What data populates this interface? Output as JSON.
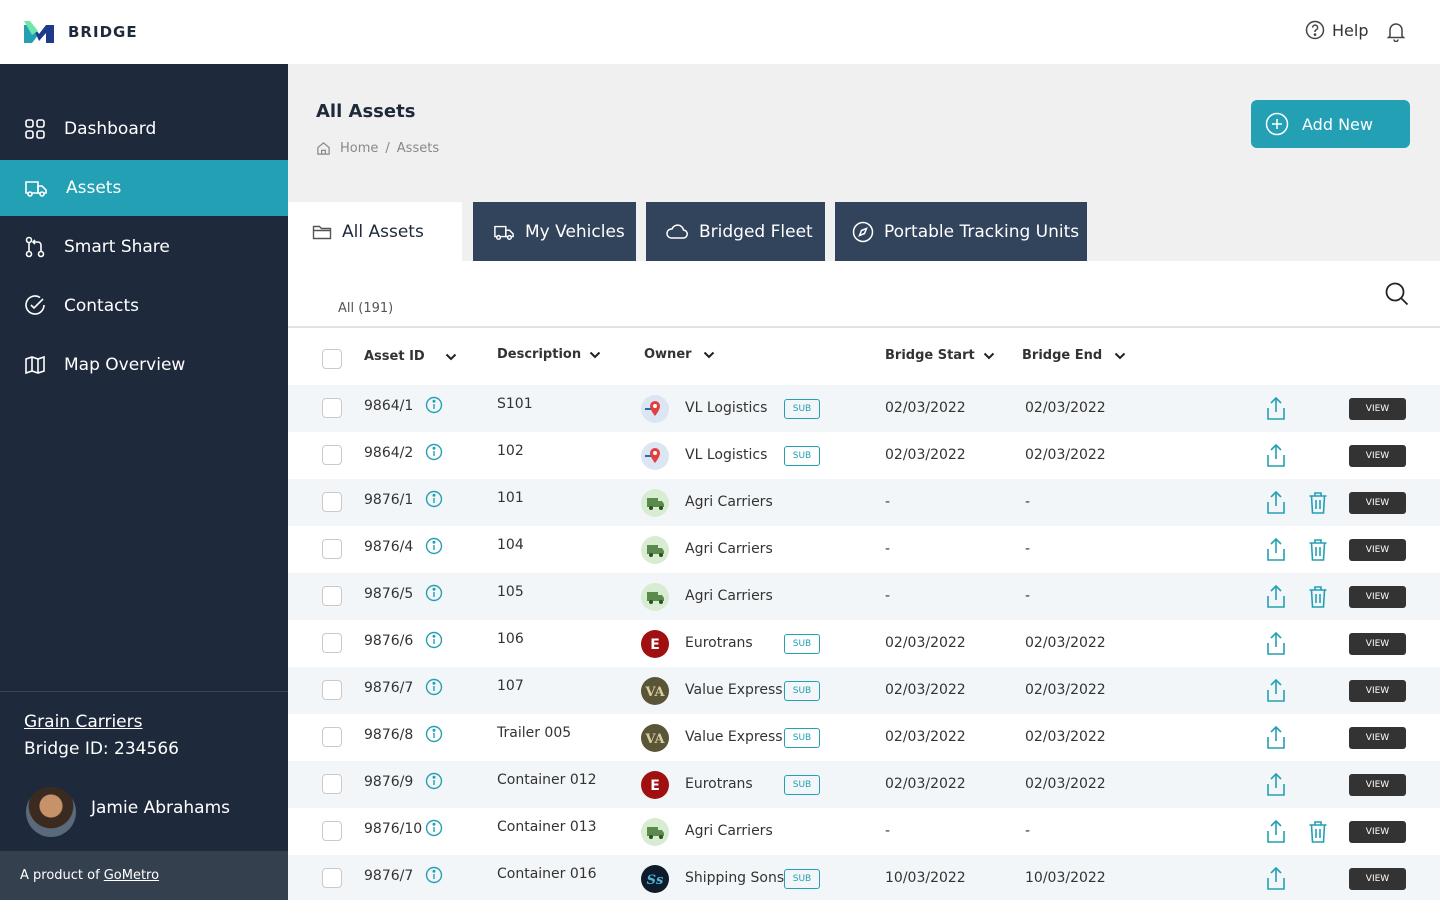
{
  "app": {
    "name": "BRIDGE"
  },
  "topbar": {
    "help_label": "Help"
  },
  "sidebar": {
    "items": [
      {
        "label": "Dashboard",
        "icon": "grid-icon",
        "active": false
      },
      {
        "label": "Assets",
        "icon": "truck-icon",
        "active": true
      },
      {
        "label": "Smart Share",
        "icon": "share-flow-icon",
        "active": false
      },
      {
        "label": "Contacts",
        "icon": "check-circle-icon",
        "active": false
      },
      {
        "label": "Map Overview",
        "icon": "map-icon",
        "active": false
      }
    ],
    "org_name": "Grain Carriers",
    "bridge_id": "Bridge ID: 234566",
    "user_name": "Jamie Abrahams",
    "footer_prefix": "A product of",
    "footer_link": "GoMetro"
  },
  "main": {
    "title": "All Assets",
    "breadcrumb": [
      "Home",
      "/",
      "Assets"
    ],
    "add_new_label": "Add New",
    "tabs": [
      {
        "label": "All Assets",
        "icon": "folder-icon",
        "active": true
      },
      {
        "label": "My Vehicles",
        "icon": "truck-icon",
        "active": false
      },
      {
        "label": "Bridged Fleet",
        "icon": "cloud-icon",
        "active": false
      },
      {
        "label": "Portable Tracking Units",
        "icon": "compass-icon",
        "active": false
      }
    ],
    "filter_label": "All (191)"
  },
  "table": {
    "columns": [
      "Asset ID",
      "Description",
      "Owner",
      "Bridge Start",
      "Bridge End"
    ],
    "sub_label": "SUB",
    "view_label": "VIEW",
    "rows": [
      {
        "asset_id": "9864/1",
        "description": "S101",
        "owner": "VL Logistics",
        "logo": "vl",
        "sub": true,
        "start": "02/03/2022",
        "end": "02/03/2022",
        "delete": false
      },
      {
        "asset_id": "9864/2",
        "description": "102",
        "owner": "VL Logistics",
        "logo": "vl",
        "sub": true,
        "start": "02/03/2022",
        "end": "02/03/2022",
        "delete": false
      },
      {
        "asset_id": "9876/1",
        "description": "101",
        "owner": "Agri Carriers",
        "logo": "agri",
        "sub": false,
        "start": "-",
        "end": "-",
        "delete": true
      },
      {
        "asset_id": "9876/4",
        "description": "104",
        "owner": "Agri Carriers",
        "logo": "agri",
        "sub": false,
        "start": "-",
        "end": "-",
        "delete": true
      },
      {
        "asset_id": "9876/5",
        "description": "105",
        "owner": "Agri Carriers",
        "logo": "agri",
        "sub": false,
        "start": "-",
        "end": "-",
        "delete": true
      },
      {
        "asset_id": "9876/6",
        "description": "106",
        "owner": "Eurotrans",
        "logo": "euro",
        "sub": true,
        "start": "02/03/2022",
        "end": "02/03/2022",
        "delete": false
      },
      {
        "asset_id": "9876/7",
        "description": "107",
        "owner": "Value Express",
        "logo": "va",
        "sub": true,
        "start": "02/03/2022",
        "end": "02/03/2022",
        "delete": false
      },
      {
        "asset_id": "9876/8",
        "description": "Trailer 005",
        "owner": "Value Express",
        "logo": "va",
        "sub": true,
        "start": "02/03/2022",
        "end": "02/03/2022",
        "delete": false
      },
      {
        "asset_id": "9876/9",
        "description": "Container 012",
        "owner": "Eurotrans",
        "logo": "euro",
        "sub": true,
        "start": "02/03/2022",
        "end": "02/03/2022",
        "delete": false
      },
      {
        "asset_id": "9876/10",
        "description": "Container 013",
        "owner": "Agri Carriers",
        "logo": "agri",
        "sub": false,
        "start": "-",
        "end": "-",
        "delete": true
      },
      {
        "asset_id": "9876/7",
        "description": "Container 016",
        "owner": "Shipping Sons",
        "logo": "ss",
        "sub": true,
        "start": "10/03/2022",
        "end": "10/03/2022",
        "delete": false
      }
    ]
  },
  "colors": {
    "accent": "#23a0b4",
    "sidebar": "#1e2a3c",
    "tab_dark": "#32435c"
  }
}
